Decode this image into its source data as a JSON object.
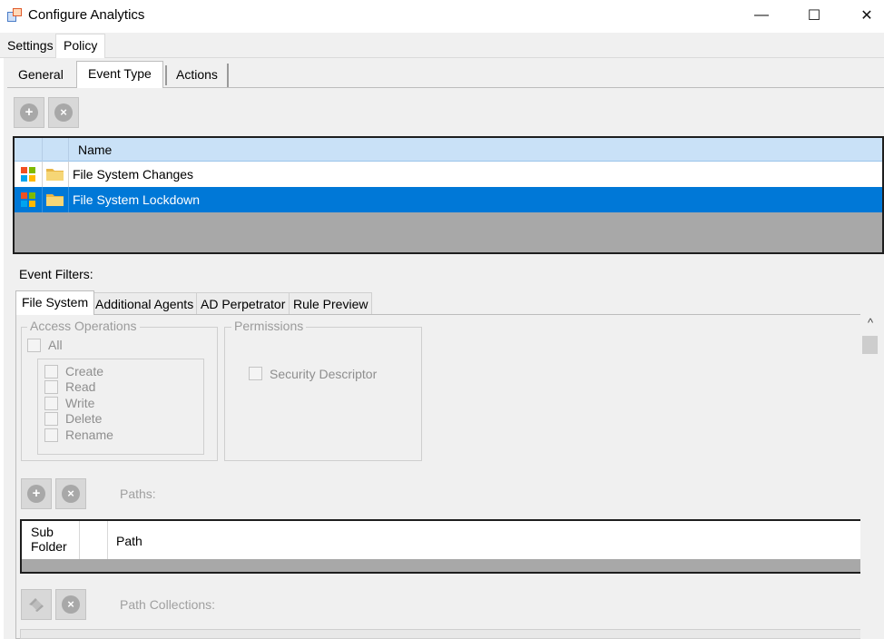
{
  "window": {
    "title": "Configure Analytics",
    "minimize_glyph": "—",
    "maximize_glyph": "☐",
    "close_glyph": "✕"
  },
  "top_tabs": [
    "Settings",
    "Policy"
  ],
  "policy_tabs": [
    "General",
    "Event Type",
    "Actions"
  ],
  "toolbar": {
    "add_glyph": "+",
    "remove_glyph": "×"
  },
  "event_type_grid": {
    "header_name": "Name",
    "rows": [
      {
        "name": "File System Changes",
        "selected": false
      },
      {
        "name": "File System Lockdown",
        "selected": true
      }
    ],
    "selection_color": "#0078d7"
  },
  "event_filters_label": "Event Filters:",
  "filter_tabs": [
    "File System",
    "Additional Agents",
    "AD Perpetrator",
    "Rule Preview"
  ],
  "access_operations": {
    "title": "Access Operations",
    "all_label": "All",
    "items": [
      "Create",
      "Read",
      "Write",
      "Delete",
      "Rename"
    ]
  },
  "permissions": {
    "title": "Permissions",
    "security_descriptor_label": "Security Descriptor"
  },
  "paths": {
    "label": "Paths:",
    "col_subfolder": "Sub\nFolder",
    "col_path": "Path"
  },
  "path_collections": {
    "label": "Path Collections:"
  },
  "scroll_up_glyph": "^"
}
